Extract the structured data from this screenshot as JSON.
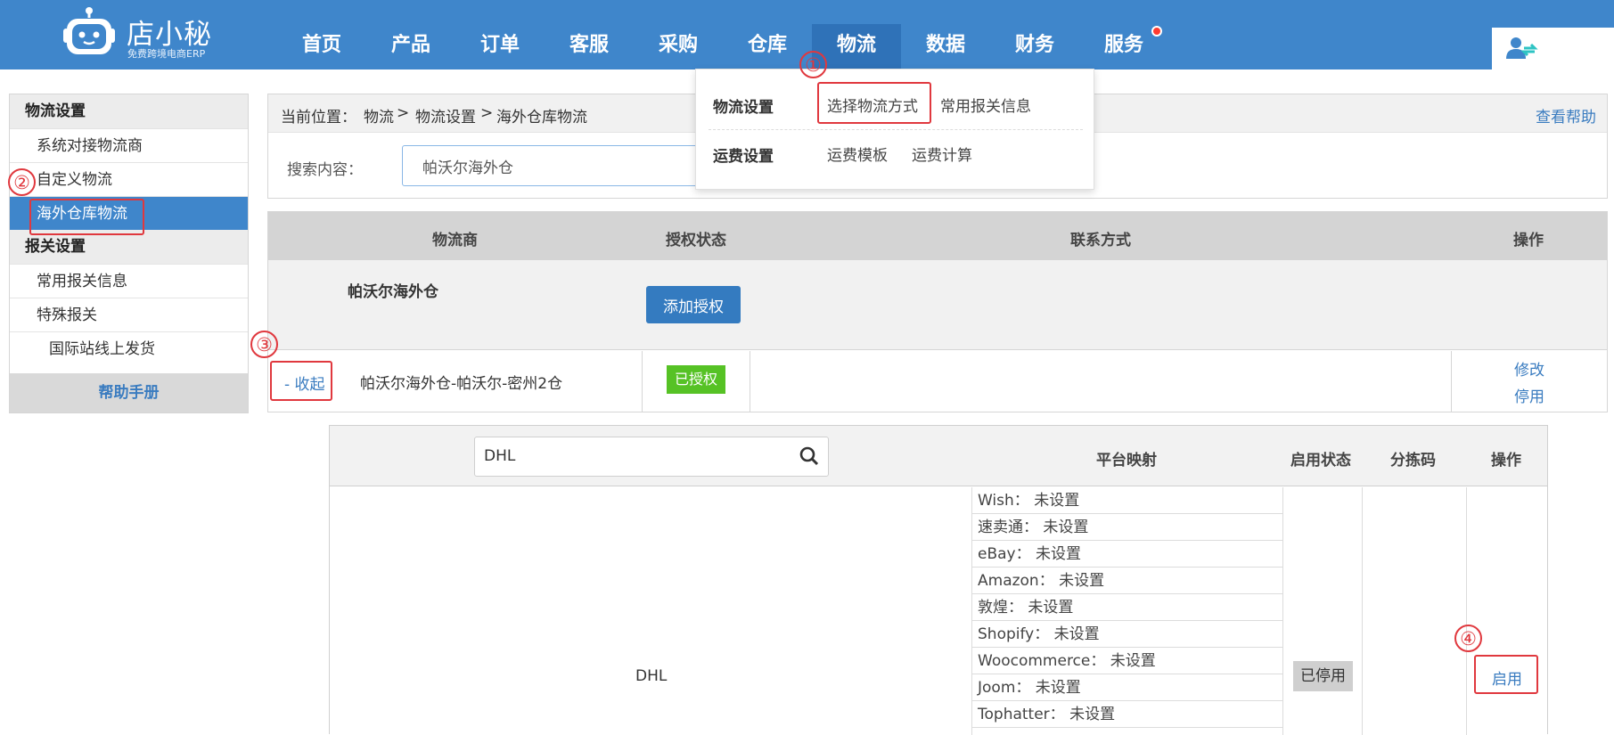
{
  "header": {
    "logo_title": "店小秘",
    "logo_subtitle": "免费跨境电商ERP",
    "nav": [
      "首页",
      "产品",
      "订单",
      "客服",
      "采购",
      "仓库",
      "物流",
      "数据",
      "财务",
      "服务"
    ],
    "active_nav": "物流",
    "brand_color": "#3f86cb"
  },
  "dropdown": {
    "group1_title": "物流设置",
    "group1_links": [
      "选择物流方式",
      "常用报关信息"
    ],
    "group2_title": "运费设置",
    "group2_links": [
      "运费模板",
      "运费计算"
    ]
  },
  "sidebar": {
    "section1_title": "物流设置",
    "section1_items": [
      "系统对接物流商",
      "自定义物流",
      "海外仓库物流"
    ],
    "section2_title": "报关设置",
    "section2_items": [
      "常用报关信息",
      "特殊报关",
      "国际站线上发货"
    ],
    "help_label": "帮助手册"
  },
  "breadcrumb": {
    "prefix": "当前位置：",
    "level1": "物流",
    "level2": "物流设置",
    "level3": "海外仓库物流",
    "sep": ">",
    "help": "查看帮助"
  },
  "search": {
    "label": "搜索内容：",
    "value": "帕沃尔海外仓"
  },
  "logistics_table": {
    "headers": {
      "provider": "物流商",
      "auth_status": "授权状态",
      "contact": "联系方式",
      "actions": "操作"
    },
    "group_name": "帕沃尔海外仓",
    "add_auth_label": "添加授权",
    "collapse_label": "- 收起",
    "account_name": "帕沃尔海外仓-帕沃尔-密州2仓",
    "auth_badge": "已授权",
    "edit_label": "修改",
    "disable_label": "停用"
  },
  "method_table": {
    "search_value": "DHL",
    "headers": {
      "mapping": "平台映射",
      "status": "启用状态",
      "sort_code": "分拣码",
      "actions": "操作"
    },
    "method_name": "DHL",
    "mappings": [
      {
        "platform": "Wish",
        "value": "未设置"
      },
      {
        "platform": "速卖通",
        "value": "未设置"
      },
      {
        "platform": "eBay",
        "value": "未设置"
      },
      {
        "platform": "Amazon",
        "value": "未设置"
      },
      {
        "platform": "敦煌",
        "value": "未设置"
      },
      {
        "platform": "Shopify",
        "value": "未设置"
      },
      {
        "platform": "Woocommerce",
        "value": "未设置"
      },
      {
        "platform": "Joom",
        "value": "未设置"
      },
      {
        "platform": "Tophatter",
        "value": "未设置"
      }
    ],
    "mapping_sep": "：",
    "status_badge": "已停用",
    "enable_label": "启用"
  },
  "annotations": [
    "①",
    "②",
    "③",
    "④"
  ]
}
